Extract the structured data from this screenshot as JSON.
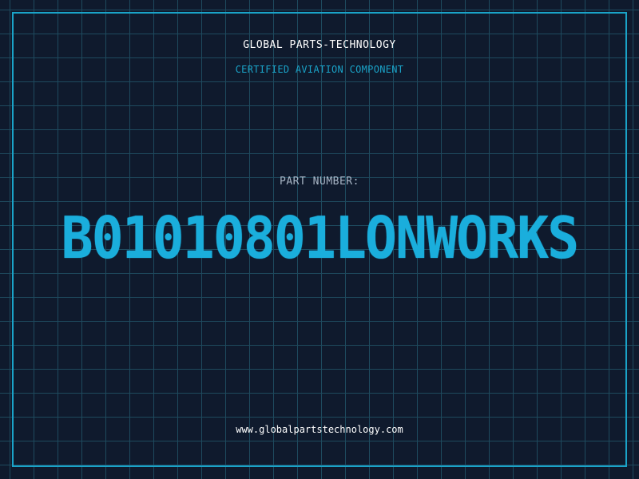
{
  "header": {
    "company": "GLOBAL PARTS-TECHNOLOGY",
    "certification": "CERTIFIED AVIATION COMPONENT"
  },
  "part": {
    "label": "PART NUMBER:",
    "number": "B01010801LONWORKS"
  },
  "footer": {
    "website": "www.globalpartstechnology.com"
  },
  "colors": {
    "background": "#0f1a2d",
    "grid": "#1e4a5e",
    "accent": "#1aa3c8",
    "part_number": "#1aaedc"
  }
}
